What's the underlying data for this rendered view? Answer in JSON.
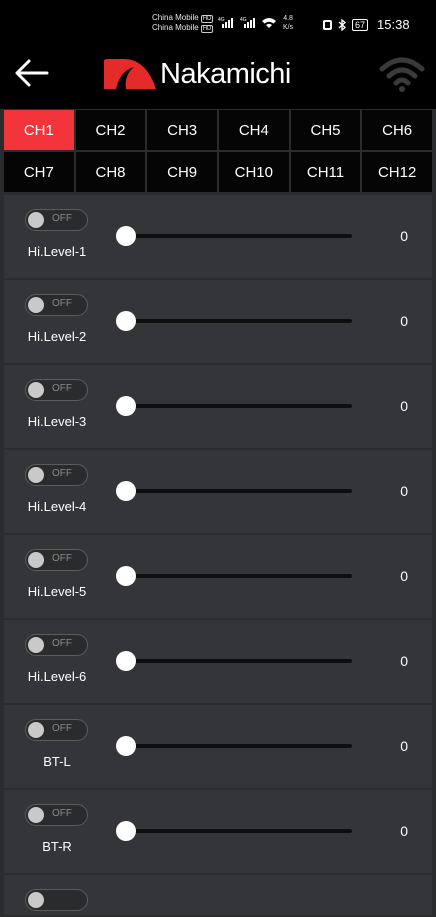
{
  "status": {
    "carrier1": "China Mobile",
    "carrier2": "China Mobile",
    "hd_badge": "HD",
    "speed_value": "4.8",
    "speed_unit": "K/s",
    "battery": "67",
    "time": "15:38"
  },
  "header": {
    "logo_text": "Nakamichi",
    "brand_color": "#e52a2a",
    "back_icon": "arrow-left-icon",
    "wifi_icon": "wifi-icon"
  },
  "tabs": [
    {
      "label": "CH1",
      "active": true
    },
    {
      "label": "CH2"
    },
    {
      "label": "CH3"
    },
    {
      "label": "CH4"
    },
    {
      "label": "CH5"
    },
    {
      "label": "CH6"
    },
    {
      "label": "CH7"
    },
    {
      "label": "CH8"
    },
    {
      "label": "CH9"
    },
    {
      "label": "CH10"
    },
    {
      "label": "CH11"
    },
    {
      "label": "CH12"
    }
  ],
  "accent_color": "#f4343b",
  "inputs": [
    {
      "label": "Hi.Level-1",
      "toggle": "OFF",
      "value": "0",
      "level": 0
    },
    {
      "label": "Hi.Level-2",
      "toggle": "OFF",
      "value": "0",
      "level": 0
    },
    {
      "label": "Hi.Level-3",
      "toggle": "OFF",
      "value": "0",
      "level": 0
    },
    {
      "label": "Hi.Level-4",
      "toggle": "OFF",
      "value": "0",
      "level": 0
    },
    {
      "label": "Hi.Level-5",
      "toggle": "OFF",
      "value": "0",
      "level": 0
    },
    {
      "label": "Hi.Level-6",
      "toggle": "OFF",
      "value": "0",
      "level": 0
    },
    {
      "label": "BT-L",
      "toggle": "OFF",
      "value": "0",
      "level": 0
    },
    {
      "label": "BT-R",
      "toggle": "OFF",
      "value": "0",
      "level": 0
    }
  ]
}
